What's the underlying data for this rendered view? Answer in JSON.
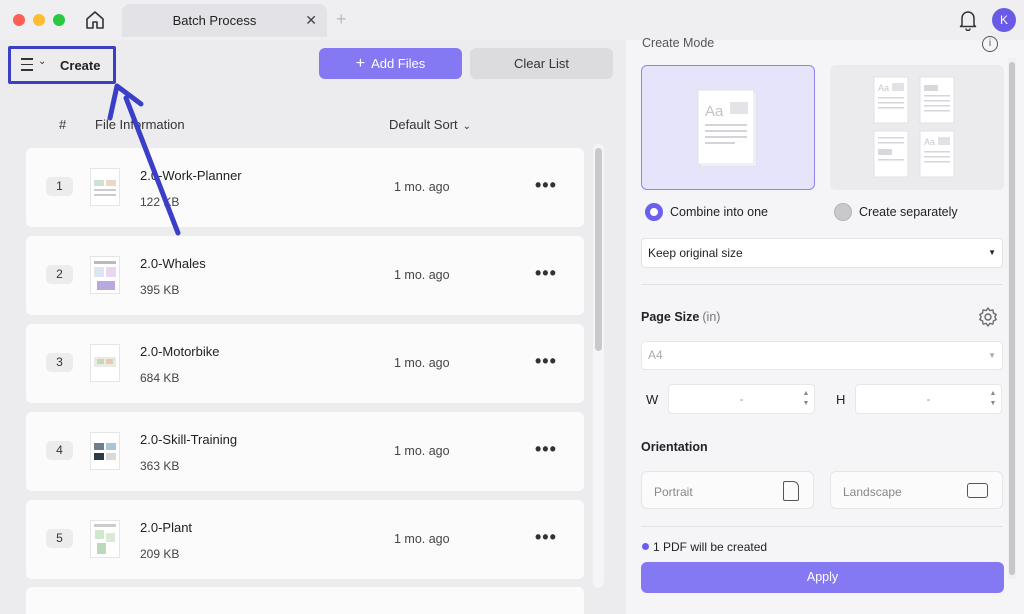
{
  "window": {
    "tab_title": "Batch Process",
    "tab_close": "✕",
    "new_tab": "+",
    "avatar_initial": "K"
  },
  "toolbar": {
    "create_label": "Create",
    "chevron": "⌄",
    "add_files_plus": "+",
    "add_files_label": "Add Files",
    "clear_list_label": "Clear List"
  },
  "list_header": {
    "hash": "#",
    "file_information": "File Information",
    "sort_label": "Default Sort",
    "sort_chevron": "⌄"
  },
  "files": [
    {
      "num": "1",
      "name": "2.0-Work-Planner",
      "size": "122 KB",
      "modified": "1 mo. ago"
    },
    {
      "num": "2",
      "name": "2.0-Whales",
      "size": "395 KB",
      "modified": "1 mo. ago"
    },
    {
      "num": "3",
      "name": "2.0-Motorbike",
      "size": "684 KB",
      "modified": "1 mo. ago"
    },
    {
      "num": "4",
      "name": "2.0-Skill-Training",
      "size": "363 KB",
      "modified": "1 mo. ago"
    },
    {
      "num": "5",
      "name": "2.0-Plant",
      "size": "209 KB",
      "modified": "1 mo. ago"
    }
  ],
  "more_glyph": "•••",
  "panel": {
    "create_mode_title": "Create Mode",
    "info_glyph": "i",
    "combine_label": "Combine into one",
    "separate_label": "Create separately",
    "size_option": "Keep original size",
    "caret": "▼",
    "page_size_title": "Page Size",
    "page_size_unit": "(in)",
    "page_size_value": "A4",
    "width_label": "W",
    "height_label": "H",
    "width_value": "-",
    "height_value": "-",
    "stepper_up": "▲",
    "stepper_down": "▼",
    "orientation_title": "Orientation",
    "portrait_label": "Portrait",
    "landscape_label": "Landscape",
    "status_text": "1 PDF will be created",
    "apply_label": "Apply"
  },
  "colors": {
    "accent": "#8479f3",
    "radio_selected": "#6b5ff0",
    "annotation": "#3b3fc8"
  }
}
